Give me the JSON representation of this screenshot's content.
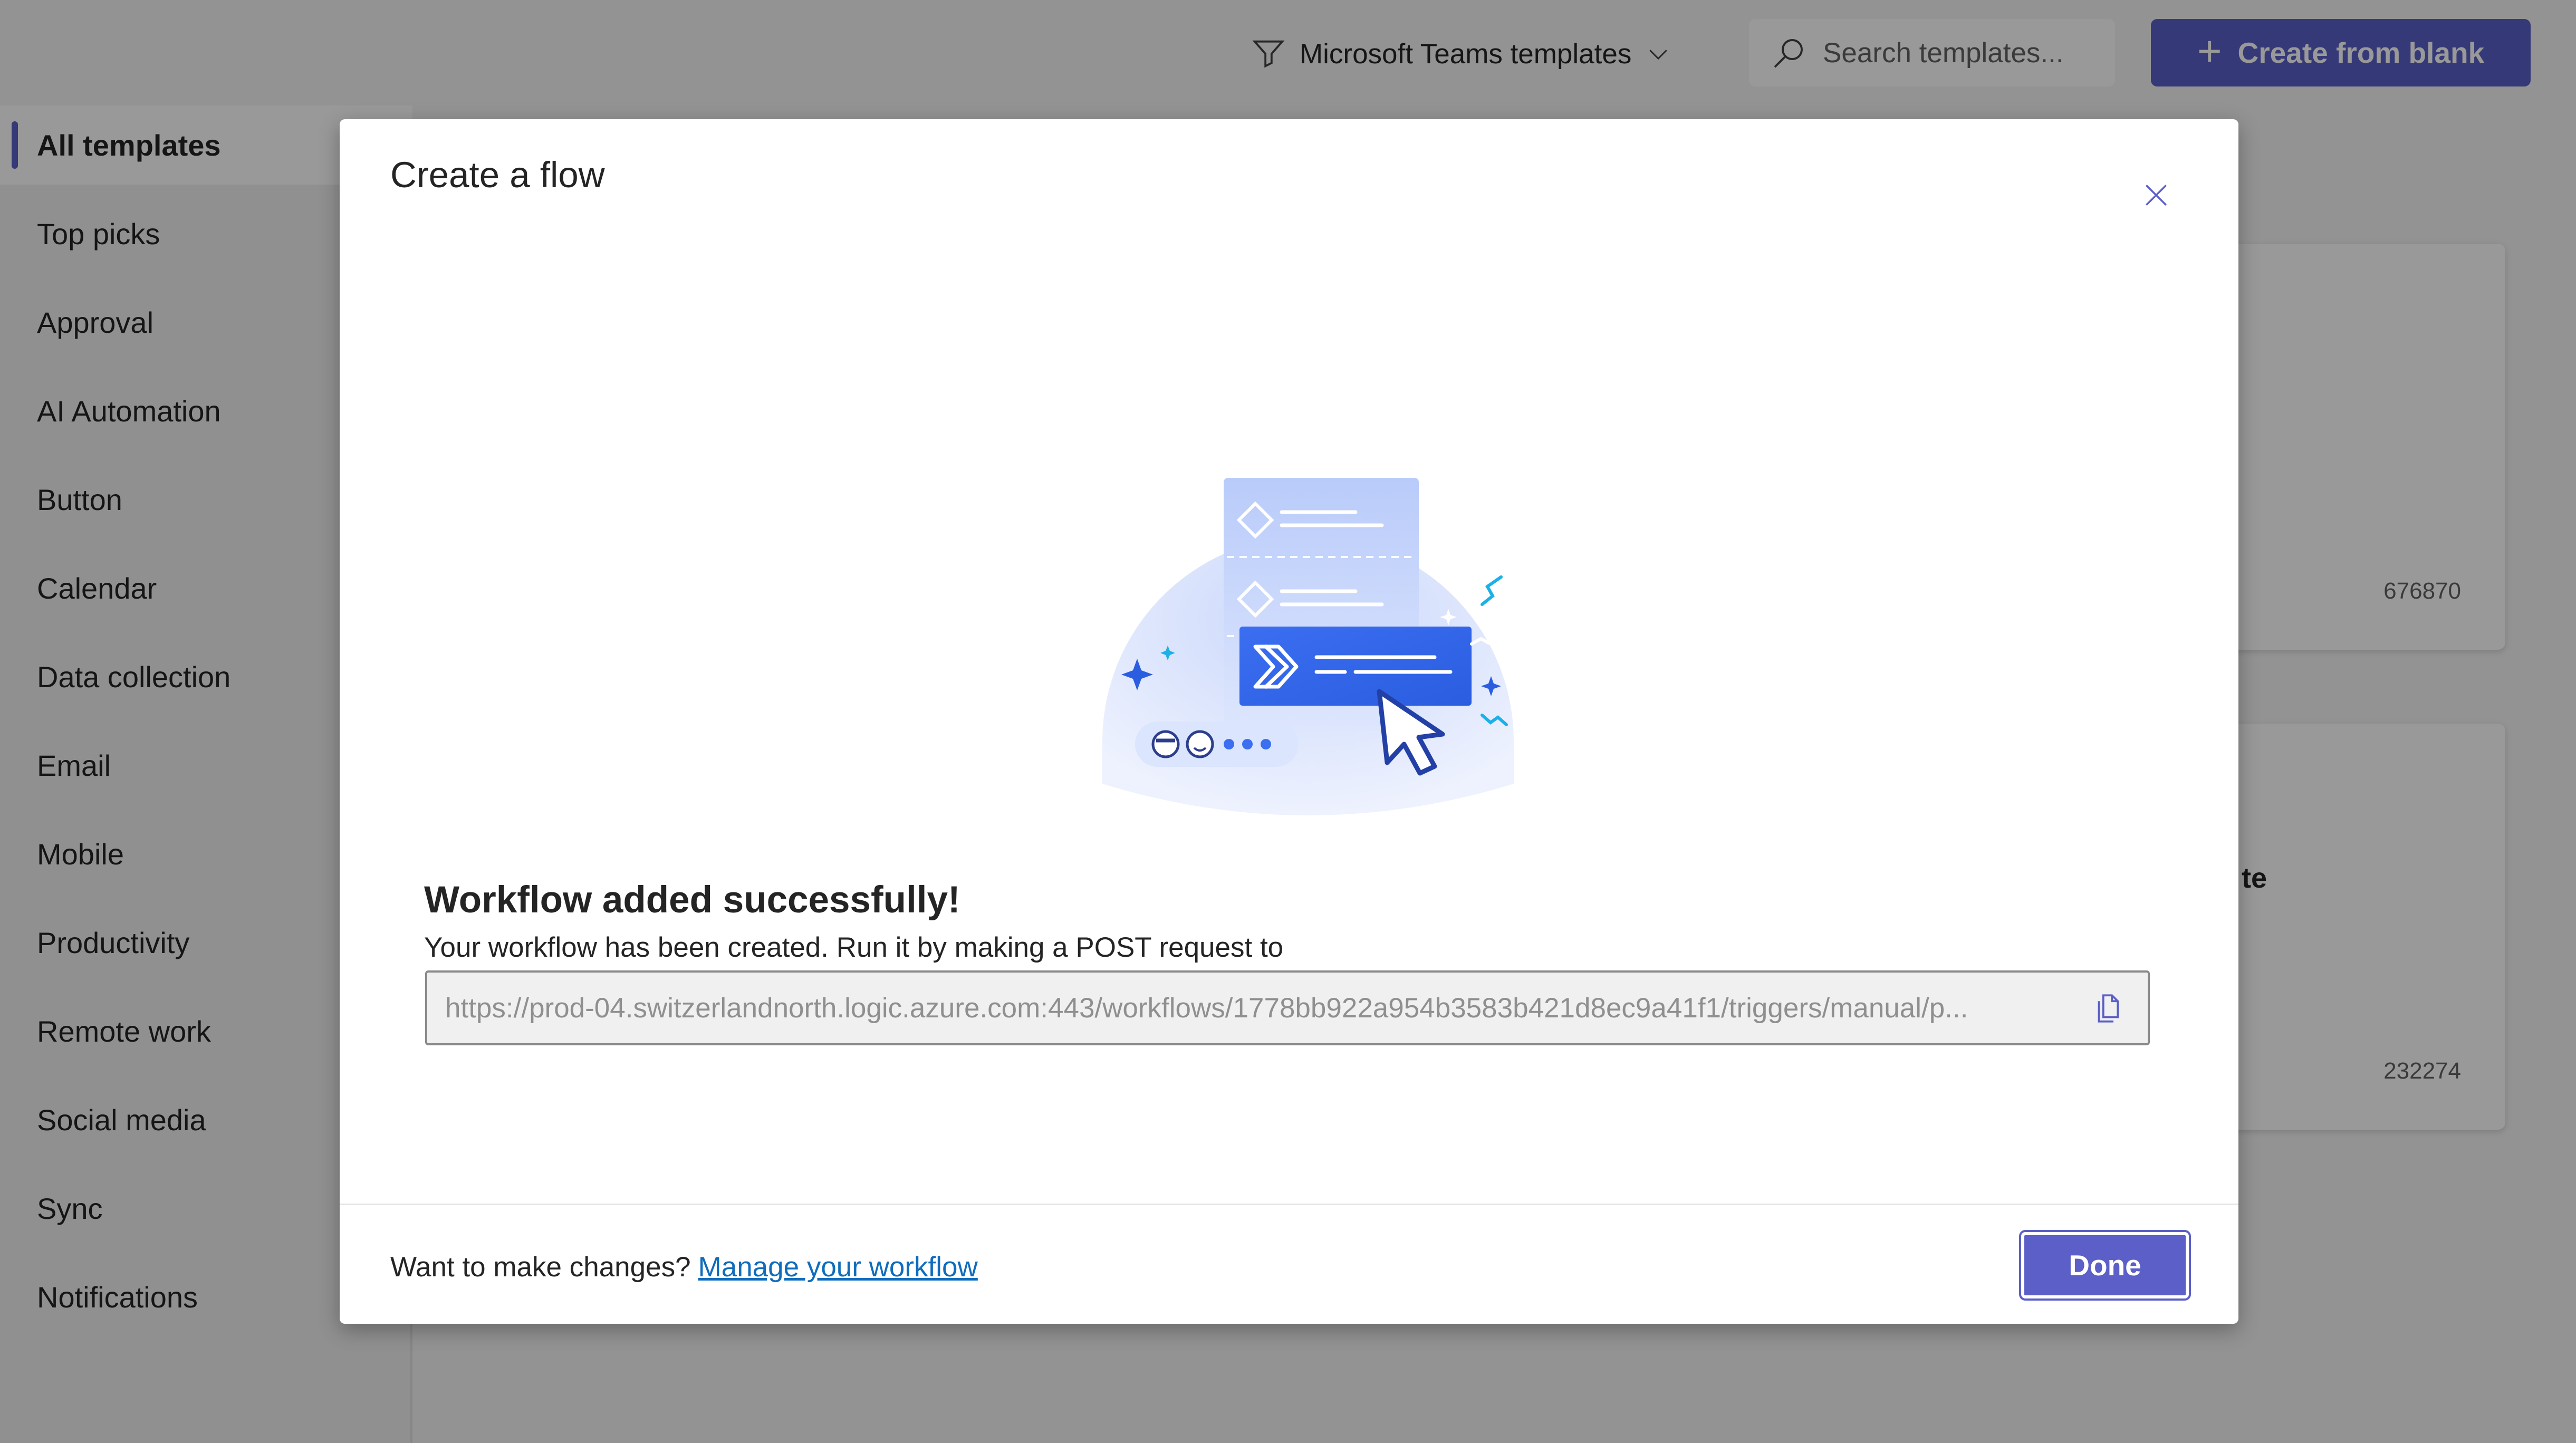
{
  "header": {
    "filter_label": "Microsoft Teams templates",
    "search_placeholder": "Search templates...",
    "create_blank_label": "Create from blank"
  },
  "sidebar": {
    "items": [
      {
        "label": "All templates",
        "active": true
      },
      {
        "label": "Top picks"
      },
      {
        "label": "Approval"
      },
      {
        "label": "AI Automation"
      },
      {
        "label": "Button"
      },
      {
        "label": "Calendar"
      },
      {
        "label": "Data collection"
      },
      {
        "label": "Email"
      },
      {
        "label": "Mobile"
      },
      {
        "label": "Productivity"
      },
      {
        "label": "Remote work"
      },
      {
        "label": "Social media"
      },
      {
        "label": "Sync"
      },
      {
        "label": "Notifications"
      }
    ]
  },
  "background_cards": [
    {
      "count": "676870"
    },
    {
      "partial_title": "te",
      "count": "232274"
    }
  ],
  "dialog": {
    "title": "Create a flow",
    "success_title": "Workflow added successfully!",
    "success_description": "Your workflow has been created. Run it by making a POST request to",
    "url": "https://prod-04.switzerlandnorth.logic.azure.com:443/workflows/1778bb922a954b3583b421d8ec9a41f1/triggers/manual/p...",
    "footer_prompt": "Want to make changes?",
    "footer_link": "Manage your workflow",
    "done_label": "Done"
  },
  "colors": {
    "brand": "#5b5fc7",
    "link": "#0f6cbd",
    "overlay": "rgba(0,0,0,0.40)"
  }
}
